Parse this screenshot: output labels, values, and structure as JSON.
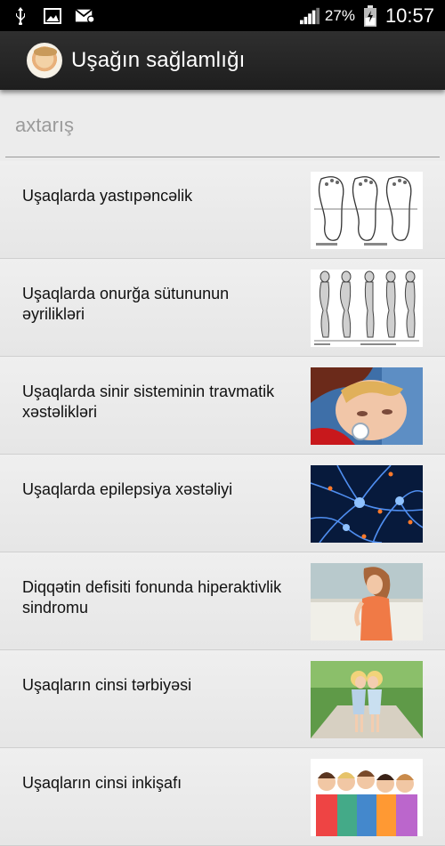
{
  "statusbar": {
    "battery": "27%",
    "time": "10:57",
    "icons": [
      "usb-icon",
      "image-icon",
      "mail-icon",
      "signal-icon",
      "battery-icon"
    ]
  },
  "actionbar": {
    "title": "Uşağın sağlamlığı",
    "app_icon": "baby-face-icon"
  },
  "search": {
    "placeholder": "axtarış",
    "value": ""
  },
  "list": {
    "items": [
      {
        "label": "Uşaqlarda yastıpəncəlik",
        "thumb": "footprint-diagram"
      },
      {
        "label": "Uşaqlarda onurğa sütununun əyrilikləri",
        "thumb": "spine-posture-diagram"
      },
      {
        "label": "Uşaqlarda sinir sisteminin travmatik xəstəlikləri",
        "thumb": "crying-child-photo"
      },
      {
        "label": "Uşaqlarda epilepsiya xəstəliyi",
        "thumb": "neurons-photo"
      },
      {
        "label": "Diqqətin defisiti fonunda hiperaktivlik sindromu",
        "thumb": "girl-by-wall-photo"
      },
      {
        "label": "Uşaqların cinsi tərbiyəsi",
        "thumb": "kissing-children-photo"
      },
      {
        "label": "Uşaqların cinsi inkişafı",
        "thumb": "group-of-kids-photo"
      }
    ]
  },
  "colors": {
    "statusbar_bg": "#000000",
    "actionbar_bg": "#262626",
    "list_bg": "#ececec",
    "text": "#111111",
    "placeholder": "#9b9b9b"
  }
}
